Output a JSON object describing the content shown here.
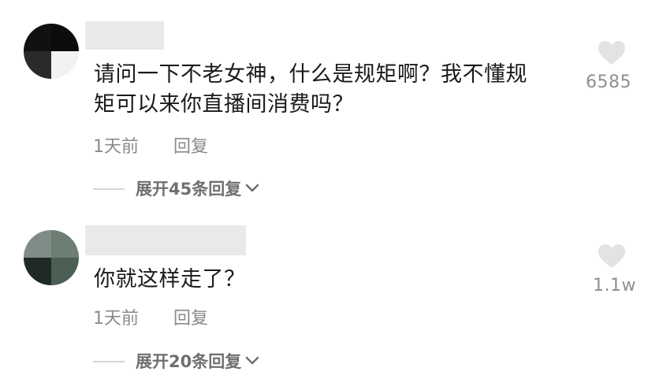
{
  "comments": [
    {
      "text_line1": "请问一下不老女神，什么是规矩啊？我不懂规",
      "text_line2": "矩可以来你直播间消费吗？",
      "time": "1天前",
      "reply_label": "回复",
      "expand_label": "展开45条回复",
      "like_count": "6585"
    },
    {
      "text_line1": "你就这样走了？",
      "time": "1天前",
      "reply_label": "回复",
      "expand_label": "展开20条回复",
      "like_count": "1.1w"
    }
  ],
  "icons": {
    "like": "heart-icon",
    "expand": "chevron-down-icon"
  },
  "colors": {
    "text": "#1a1a1a",
    "meta": "#8a8a8a",
    "heart": "#e3e3e3"
  }
}
